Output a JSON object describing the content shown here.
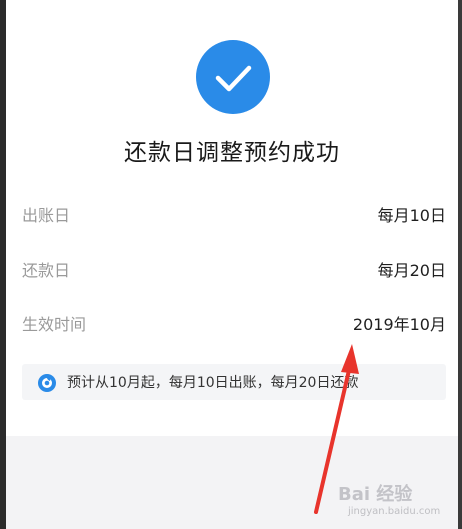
{
  "result": {
    "title": "还款日调整预约成功"
  },
  "details": [
    {
      "label": "出账日",
      "value": "每月10日"
    },
    {
      "label": "还款日",
      "value": "每月20日"
    },
    {
      "label": "生效时间",
      "value": "2019年10月"
    }
  ],
  "notice": {
    "text": "预计从10月起，每月10日出账，每月20日还款"
  },
  "watermark": {
    "main": "Bai 经验",
    "sub": "jingyan.baidu.com"
  },
  "colors": {
    "accent_blue": "#2a8be8",
    "annotation_red": "#e8342c",
    "notice_bg": "#f4f5f7"
  },
  "icons": {
    "success": "check-circle-icon",
    "notice": "info-drop-icon",
    "annotation": "red-arrow-icon"
  }
}
